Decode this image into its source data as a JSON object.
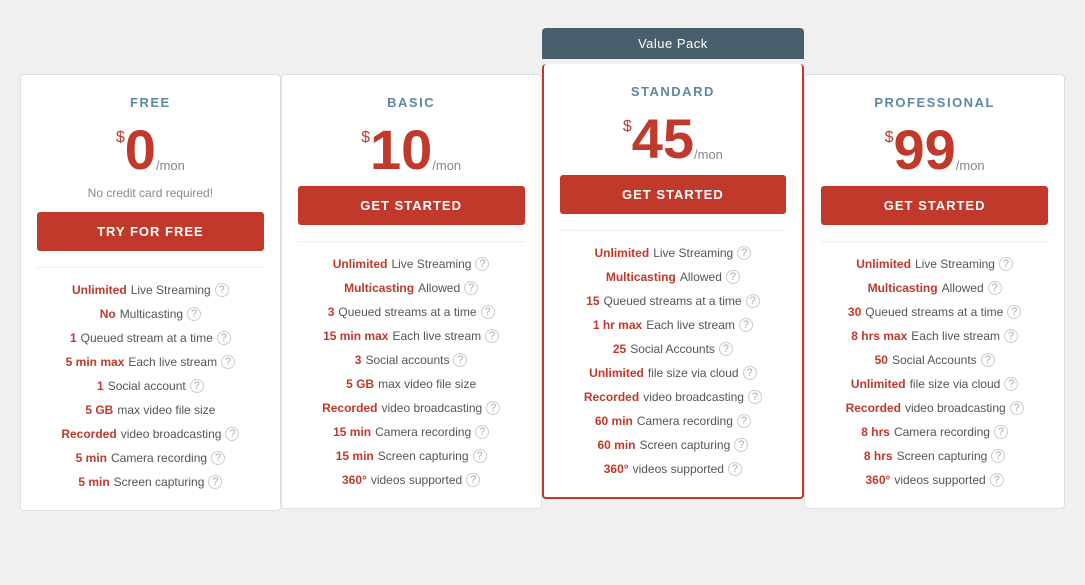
{
  "plans": [
    {
      "id": "free",
      "title": "FREE",
      "price": "0",
      "per": "/mon",
      "no_credit": "No credit card required!",
      "cta": "TRY FOR FREE",
      "featured": false,
      "features": [
        {
          "highlight": "Unlimited",
          "text": " Live Streaming",
          "info": true
        },
        {
          "highlight": "No",
          "text": " Multicasting",
          "info": true
        },
        {
          "highlight": "1",
          "text": " Queued stream at a time",
          "info": true
        },
        {
          "highlight": "5 min max",
          "text": " Each live stream",
          "info": true
        },
        {
          "highlight": "1",
          "text": " Social account",
          "info": true
        },
        {
          "highlight": "5 GB",
          "text": " max video file size",
          "info": false
        },
        {
          "highlight": "Recorded",
          "text": " video broadcasting",
          "info": true
        },
        {
          "highlight": "5 min",
          "text": " Camera recording",
          "info": true
        },
        {
          "highlight": "5 min",
          "text": " Screen capturing",
          "info": true
        }
      ]
    },
    {
      "id": "basic",
      "title": "BASIC",
      "price": "10",
      "per": "/mon",
      "no_credit": "",
      "cta": "GET STARTED",
      "featured": false,
      "features": [
        {
          "highlight": "Unlimited",
          "text": " Live Streaming",
          "info": true
        },
        {
          "highlight": "Multicasting",
          "text": " Allowed",
          "info": true
        },
        {
          "highlight": "3",
          "text": " Queued streams at a time",
          "info": true
        },
        {
          "highlight": "15 min max",
          "text": " Each live stream",
          "info": true
        },
        {
          "highlight": "3",
          "text": " Social accounts",
          "info": true
        },
        {
          "highlight": "5 GB",
          "text": " max video file size",
          "info": false
        },
        {
          "highlight": "Recorded",
          "text": " video broadcasting",
          "info": true
        },
        {
          "highlight": "15 min",
          "text": " Camera recording",
          "info": true
        },
        {
          "highlight": "15 min",
          "text": " Screen capturing",
          "info": true
        },
        {
          "highlight": "360°",
          "text": " videos supported",
          "info": true
        }
      ]
    },
    {
      "id": "standard",
      "title": "STANDARD",
      "price": "45",
      "per": "/mon",
      "no_credit": "",
      "cta": "GET STARTED",
      "featured": true,
      "badge": "Value Pack",
      "features": [
        {
          "highlight": "Unlimited",
          "text": " Live Streaming",
          "info": true
        },
        {
          "highlight": "Multicasting",
          "text": " Allowed",
          "info": true
        },
        {
          "highlight": "15",
          "text": " Queued streams at a time",
          "info": true
        },
        {
          "highlight": "1 hr max",
          "text": " Each live stream",
          "info": true
        },
        {
          "highlight": "25",
          "text": " Social Accounts",
          "info": true
        },
        {
          "highlight": "Unlimited",
          "text": " file size via cloud",
          "info": true
        },
        {
          "highlight": "Recorded",
          "text": " video broadcasting",
          "info": true
        },
        {
          "highlight": "60 min",
          "text": " Camera recording",
          "info": true
        },
        {
          "highlight": "60 min",
          "text": " Screen capturing",
          "info": true
        },
        {
          "highlight": "360°",
          "text": " videos supported",
          "info": true
        }
      ]
    },
    {
      "id": "professional",
      "title": "PROFESSIONAL",
      "price": "99",
      "per": "/mon",
      "no_credit": "",
      "cta": "GET STARTED",
      "featured": false,
      "features": [
        {
          "highlight": "Unlimited",
          "text": " Live Streaming",
          "info": true
        },
        {
          "highlight": "Multicasting",
          "text": " Allowed",
          "info": true
        },
        {
          "highlight": "30",
          "text": " Queued streams at a time",
          "info": true
        },
        {
          "highlight": "8 hrs max",
          "text": " Each live stream",
          "info": true
        },
        {
          "highlight": "50",
          "text": " Social Accounts",
          "info": true
        },
        {
          "highlight": "Unlimited",
          "text": " file size via cloud",
          "info": true
        },
        {
          "highlight": "Recorded",
          "text": " video broadcasting",
          "info": true
        },
        {
          "highlight": "8 hrs",
          "text": " Camera recording",
          "info": true
        },
        {
          "highlight": "8 hrs",
          "text": " Screen capturing",
          "info": true
        },
        {
          "highlight": "360°",
          "text": " videos supported",
          "info": true
        }
      ]
    }
  ]
}
